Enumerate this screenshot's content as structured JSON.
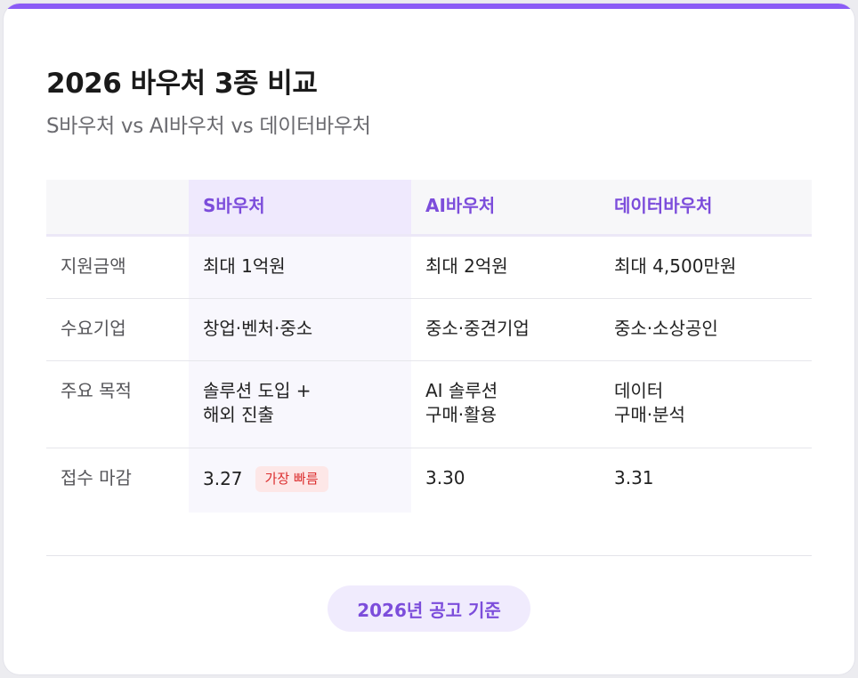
{
  "header": {
    "title": "2026 바우처 3종 비교",
    "subtitle": "S바우처 vs AI바우처 vs 데이터바우처"
  },
  "table": {
    "columns": [
      "",
      "S바우처",
      "AI바우처",
      "데이터바우처"
    ],
    "rows": [
      {
        "label": "지원금액",
        "cells": [
          [
            "최대 1억원"
          ],
          [
            "최대 2억원"
          ],
          [
            "최대 4,500만원"
          ]
        ]
      },
      {
        "label": "수요기업",
        "cells": [
          [
            "창업·벤처·중소"
          ],
          [
            "중소·중견기업"
          ],
          [
            "중소·소상공인"
          ]
        ]
      },
      {
        "label": "주요 목적",
        "cells": [
          [
            "솔루션 도입 +",
            "해외 진출"
          ],
          [
            "AI 솔루션",
            "구매·활용"
          ],
          [
            "데이터",
            "구매·분석"
          ]
        ]
      },
      {
        "label": "접수 마감",
        "cells": [
          [
            "3.27"
          ],
          [
            "3.30"
          ],
          [
            "3.31"
          ]
        ],
        "badge": "가장 빠름"
      }
    ]
  },
  "footer": {
    "note": "2026년 공고 기준"
  },
  "colors": {
    "accent": "#8b5cf6",
    "accent_text": "#7c4ddb",
    "badge_bg": "#fde7e7",
    "badge_text": "#dc3030"
  }
}
